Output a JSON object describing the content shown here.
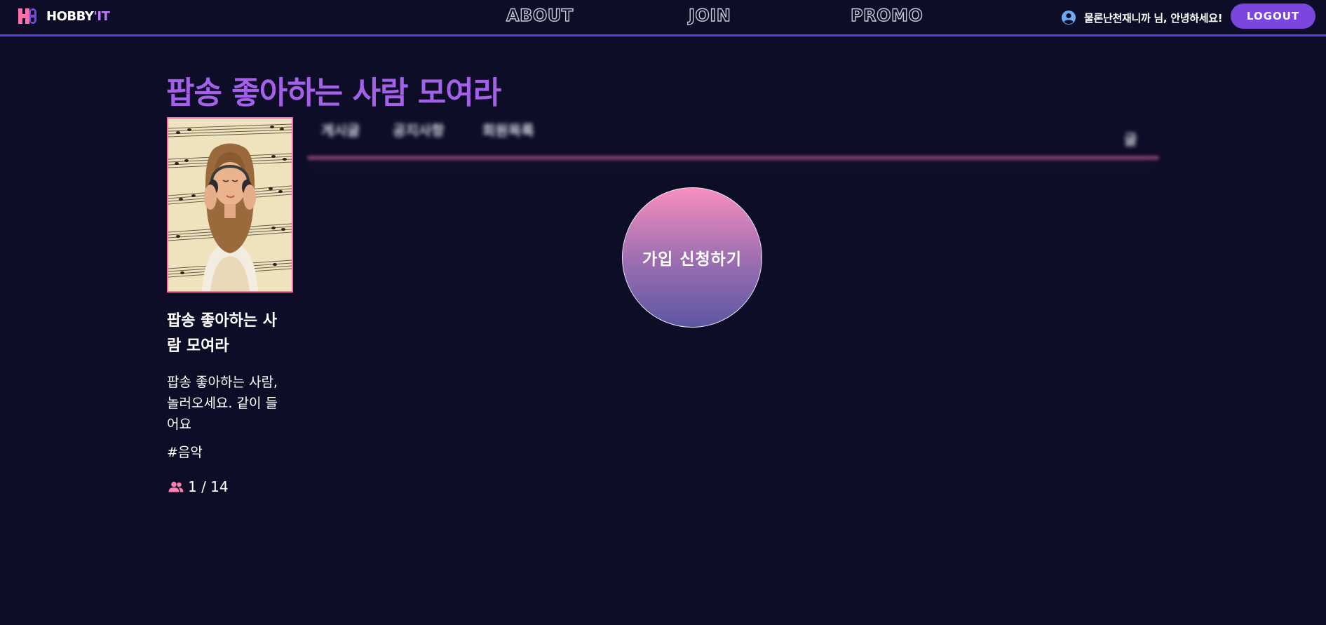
{
  "header": {
    "logo_text": "HOBBY",
    "logo_accent": "'IT",
    "nav": {
      "about": "ABOUT",
      "join": "JOIN",
      "promo": "PROMO"
    },
    "greeting": "물론난천재니까 님, 안녕하세요!",
    "logout_label": "LOGOUT"
  },
  "club": {
    "title": "팝송 좋아하는 사람 모여라",
    "name": "팝송 좋아하는 사람 모여라",
    "description": "팝송 좋아하는 사람, 놀러오세요. 같이 들어요",
    "tag": "#음악",
    "members": "1 / 14"
  },
  "tabs": {
    "items": [
      {
        "label": "게시글"
      },
      {
        "label": "공지사항"
      },
      {
        "label": "회원목록"
      }
    ],
    "write_label": "글"
  },
  "join_button_label": "가입 신청하기",
  "colors": {
    "background": "#0d0d27",
    "accent": "#7b45e0",
    "title": "#a460e8",
    "pink": "#ff6fa8"
  }
}
